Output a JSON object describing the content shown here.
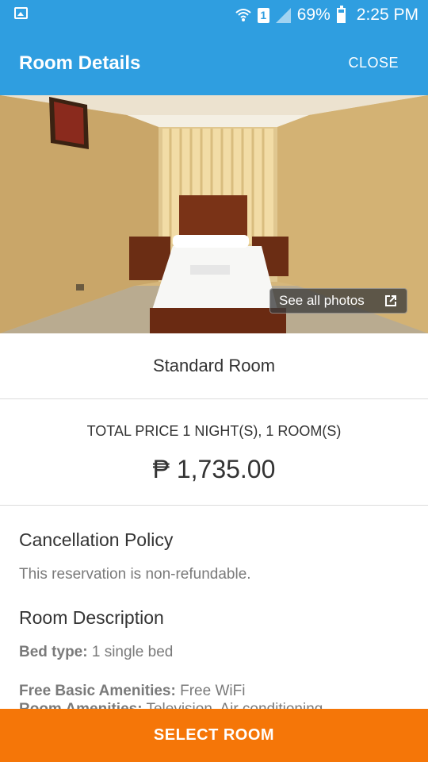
{
  "status_bar": {
    "sim_label": "1",
    "battery": "69%",
    "time": "2:25 PM"
  },
  "app_bar": {
    "title": "Room Details",
    "close_label": "CLOSE"
  },
  "hero": {
    "see_all_photos_label": "See all photos"
  },
  "room": {
    "name": "Standard Room"
  },
  "price": {
    "label": "TOTAL PRICE 1 NIGHT(S), 1 ROOM(S)",
    "value": "₱  1,735.00"
  },
  "cancellation": {
    "heading": "Cancellation Policy",
    "text": "This reservation is non-refundable."
  },
  "description": {
    "heading": "Room Description",
    "bed_type_key": "Bed type:",
    "bed_type_value": " 1 single bed",
    "amenities_key": "Free Basic Amenities:",
    "amenities_value": " Free WiFi",
    "room_amenities_key": "Room Amenities:",
    "room_amenities_value": " Television, Air conditioning"
  },
  "footer": {
    "select_label": "SELECT ROOM"
  },
  "colors": {
    "primary": "#2f9ee0",
    "accent": "#f57608"
  }
}
